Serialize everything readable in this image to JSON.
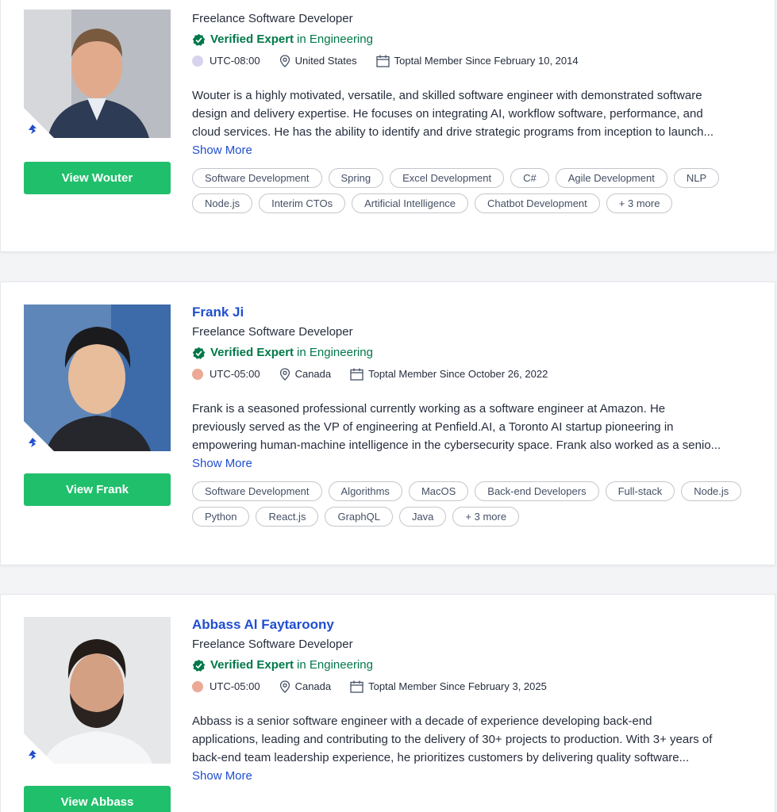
{
  "brand": {
    "green": "#20bf6b",
    "verified_green": "#00784a",
    "link_blue": "#204ecf"
  },
  "cards": [
    {
      "name": "",
      "title": "Freelance Software Developer",
      "verified_label": "Verified Expert",
      "verified_suffix": "in Engineering",
      "tz_color": "#d7d3ee",
      "timezone": "UTC-08:00",
      "location": "United States",
      "member_since": "Toptal Member Since February 10, 2014",
      "description": [
        "Wouter is a highly motivated, versatile, and skilled software engineer with demonstrated software",
        "design and delivery expertise. He focuses on integrating AI, workflow software, performance, and",
        "cloud services. He has the ability to identify and drive strategic programs from inception to launch..."
      ],
      "show_more": "Show More",
      "button": "View Wouter",
      "skills": [
        "Software Development",
        "Spring",
        "Excel Development",
        "C#",
        "Agile Development",
        "NLP",
        "Node.js",
        "Interim CTOs",
        "Artificial Intelligence",
        "Chatbot Development",
        "+ 3 more"
      ],
      "photo_icon": "portrait-suit-man"
    },
    {
      "name": "Frank Ji",
      "title": "Freelance Software Developer",
      "verified_label": "Verified Expert",
      "verified_suffix": "in Engineering",
      "tz_color": "#eba996",
      "timezone": "UTC-05:00",
      "location": "Canada",
      "member_since": "Toptal Member Since October 26, 2022",
      "description": [
        "Frank is a seasoned professional currently working as a software engineer at Amazon. He",
        "previously served as the VP of engineering at Penfield.AI, a Toronto AI startup pioneering in",
        "empowering human-machine intelligence in the cybersecurity space. Frank also worked as a senio..."
      ],
      "show_more": "Show More",
      "button": "View Frank",
      "skills": [
        "Software Development",
        "Algorithms",
        "MacOS",
        "Back-end Developers",
        "Full-stack",
        "Node.js",
        "Python",
        "React.js",
        "GraphQL",
        "Java",
        "+ 3 more"
      ],
      "photo_icon": "portrait-blue-background"
    },
    {
      "name": "Abbass Al Faytaroony",
      "title": "Freelance Software Developer",
      "verified_label": "Verified Expert",
      "verified_suffix": "in Engineering",
      "tz_color": "#eba996",
      "timezone": "UTC-05:00",
      "location": "Canada",
      "member_since": "Toptal Member Since February 3, 2025",
      "description": [
        "Abbass is a senior software engineer with a decade of experience developing back-end",
        "applications, leading and contributing to the delivery of 30+ projects to production. With 3+ years of",
        "back-end team leadership experience, he prioritizes customers by delivering quality software..."
      ],
      "show_more": "Show More",
      "button": "View Abbass",
      "skills": [],
      "photo_icon": "portrait-bearded-man"
    }
  ]
}
